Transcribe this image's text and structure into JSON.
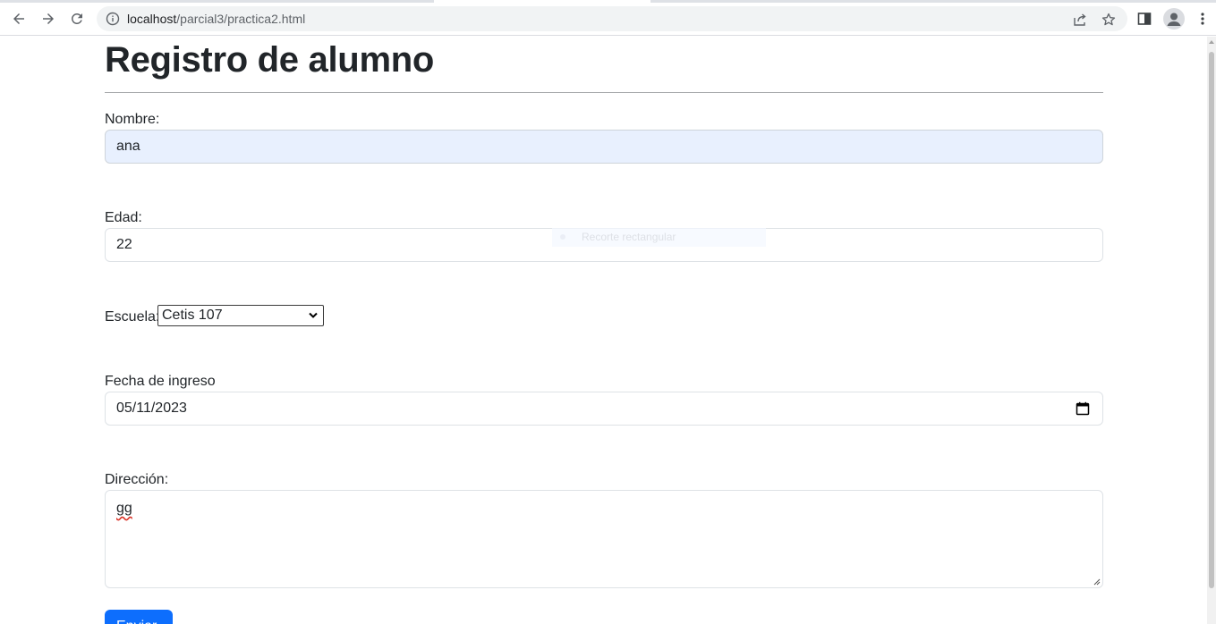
{
  "browser": {
    "url_host": "localhost",
    "url_path": "/parcial3/practica2.html"
  },
  "page": {
    "title": "Registro de alumno",
    "nombre": {
      "label": "Nombre:",
      "value": "ana"
    },
    "edad": {
      "label": "Edad:",
      "value": "22"
    },
    "escuela": {
      "label": "Escuela:",
      "selected": "Cetis 107"
    },
    "fecha": {
      "label": "Fecha de ingreso",
      "value": "05/11/2023"
    },
    "direccion": {
      "label": "Dirección:",
      "value": "gg"
    },
    "submit_label": "Enviar"
  },
  "overlay": {
    "snip_label": "Recorte rectangular"
  },
  "colors": {
    "primary": "#0d6efd",
    "autofill_bg": "#e8f0fe"
  }
}
